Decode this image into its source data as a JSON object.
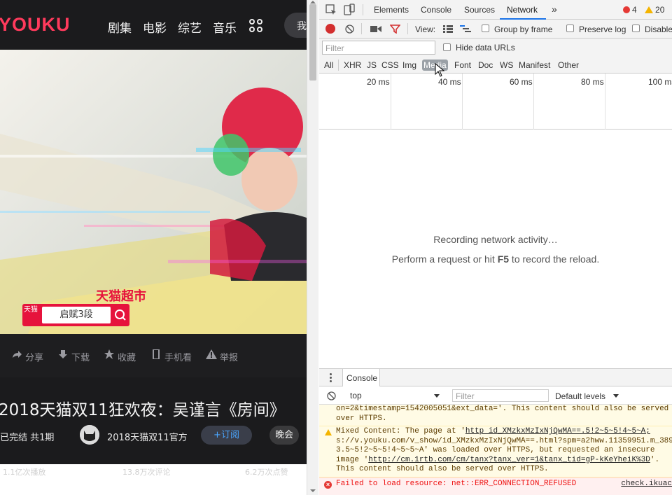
{
  "youku": {
    "logo": "YOUKU",
    "nav": [
      "剧集",
      "电影",
      "综艺",
      "音乐"
    ],
    "me_button": "我",
    "ad": {
      "brand_text": "天猫超市",
      "badge": "天猫",
      "search_text": "启赋3段"
    },
    "actions": [
      "分享",
      "下载",
      "收藏",
      "手机看",
      "举报"
    ],
    "title": "2018天猫双11狂欢夜：吴谨言《房间》",
    "status": "已完结 共1期",
    "channel": "2018天猫双11官方",
    "subscribe": "+订阅",
    "tag": "晚会",
    "bottom_counts": [
      "1.1亿次播放",
      "13.8万次评论",
      "6.2万次点赞"
    ]
  },
  "devtools": {
    "tabs": [
      "Elements",
      "Console",
      "Sources",
      "Network"
    ],
    "active_tab": "Network",
    "more": "»",
    "errors": "4",
    "warnings": "20",
    "toolbar": {
      "view": "View:",
      "group_by_frame": "Group by frame",
      "preserve_log": "Preserve log",
      "disable_cache": "Disable cache"
    },
    "filter_placeholder": "Filter",
    "hide_data_urls": "Hide data URLs",
    "types": [
      "All",
      "XHR",
      "JS",
      "CSS",
      "Img",
      "Media",
      "Font",
      "Doc",
      "WS",
      "Manifest",
      "Other"
    ],
    "hovered_type": "Media",
    "timeline_ticks": [
      "20 ms",
      "40 ms",
      "60 ms",
      "80 ms",
      "100 ms"
    ],
    "empty_line1": "Recording network activity…",
    "empty_line2_pre": "Perform a request or hit ",
    "empty_line2_key": "F5",
    "empty_line2_post": " to record the reload.",
    "drawer_tab": "Console",
    "console": {
      "context": "top",
      "filter_placeholder": "Filter",
      "levels": "Default levels",
      "messages": {
        "w1_line1": "on=2&timestamp=1542005051&ext_data='. This content should also be served",
        "w1_line2": "over HTTPS.",
        "w2_line1_pre": "Mixed Content: The page at '",
        "w2_line1_link": "http  id_XMzkxMzIxNjQwMA==.5!2~5~5!4~5~A;",
        "w2_line2": "s://v.youku.com/v_show/id_XMzkxMzIxNjQwMA==.html?spm=a2hww.11359951.m_389",
        "w2_line3": "3.5~5!2~5~5!4~5~5~A' was loaded over HTTPS, but requested an insecure",
        "w2_line4_pre": "image '",
        "w2_line4_link": "http://cm.1rtb.com/cm/tanx?tanx_ver=1&tanx_tid=gP-kKeYheiK%3D",
        "w2_line4_post": "'.",
        "w2_line5": "This content should also be served over HTTPS.",
        "err": "Failed to load resource: net::ERR_CONNECTION_REFUSED",
        "err_source": "check.ikuac"
      }
    }
  },
  "colors": {
    "youku_pink": "#ff3a5c",
    "youku_blue": "#2ab7ff",
    "tmall_red": "#e6133c",
    "devtools_bg": "#f3f3f3",
    "active_underline": "#1a73e8"
  }
}
